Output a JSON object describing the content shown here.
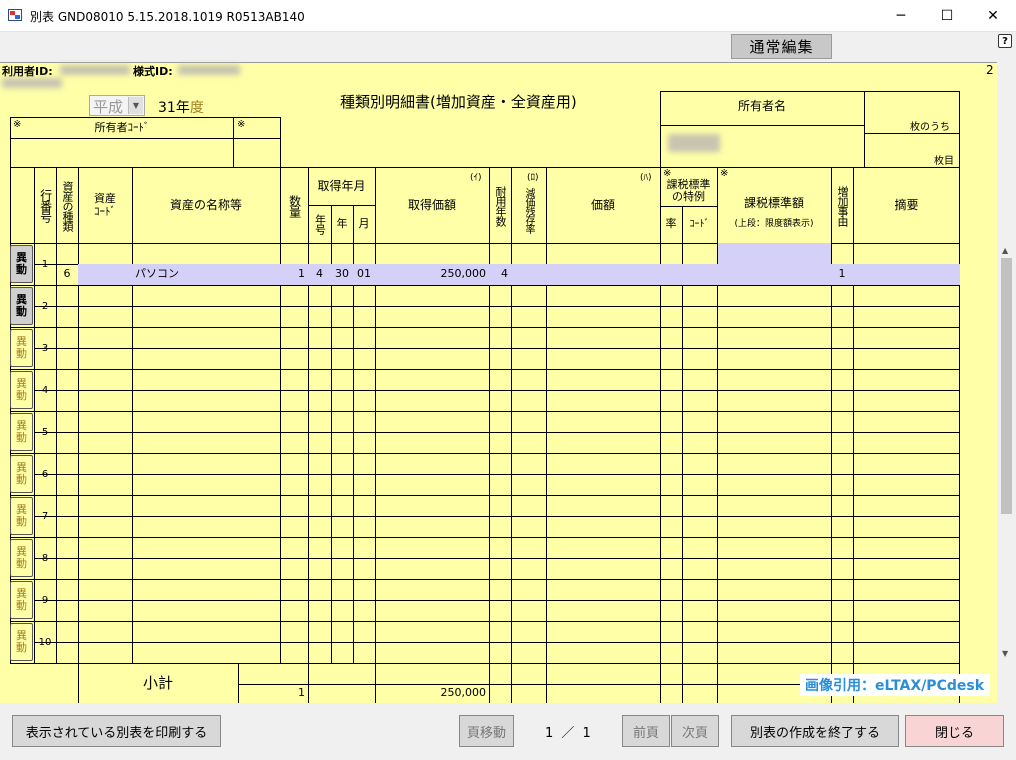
{
  "window": {
    "title": "別表 GND08010  5.15.2018.1019  R0513AB140",
    "minimize": "─",
    "maximize": "☐",
    "close": "✕"
  },
  "toolbar": {
    "mode_label": "通常編集",
    "help_icon": "?"
  },
  "header": {
    "user_id_label": "利用者ID:",
    "form_id_label": "様式ID:",
    "page_no": "2",
    "era": "平成",
    "year": "31年",
    "year_suffix": "度",
    "doc_title": "種類別明細書(増加資産・全資産用)",
    "owner_name_label": "所有者名",
    "sheet_of": "枚のうち",
    "sheet_no": "枚目",
    "owner_code_mark": "※",
    "owner_code_label": "所有者ｺｰﾄﾞ",
    "owner_code_mark2": "※"
  },
  "columns": {
    "row_no": "行番号",
    "asset_type": "資産の種類",
    "asset_code": "資産ｺｰﾄﾞ",
    "asset_name": "資産の名称等",
    "quantity": "数量",
    "acq_date": "取得年月",
    "acq_era": "年号",
    "acq_year": "年",
    "acq_month": "月",
    "acq_price_mark": "(ｲ)",
    "acq_price": "取得価額",
    "useful_life": "耐用年数",
    "residual_mark": "(ﾛ)",
    "residual": "減価残存率",
    "value_mark": "(ﾊ)",
    "value": "価額",
    "tax_special_mark": "※",
    "tax_special": "課税標準の特例",
    "tax_rate": "率",
    "tax_code": "ｺｰﾄﾞ",
    "tax_base_mark": "※",
    "tax_base": "課税標準額",
    "tax_base_note": "(上段：限度額表示)",
    "increase_reason": "増加事由",
    "remarks": "摘要"
  },
  "ido_label": "異動",
  "rows": [
    {
      "no": "1",
      "type": "6",
      "code": "",
      "name": "パソコン",
      "qty": "1",
      "era": "4",
      "year": "30",
      "month": "01",
      "price": "250,000",
      "life": "4",
      "reason": "1"
    },
    {
      "no": "2"
    },
    {
      "no": "3"
    },
    {
      "no": "4"
    },
    {
      "no": "5"
    },
    {
      "no": "6"
    },
    {
      "no": "7"
    },
    {
      "no": "8"
    },
    {
      "no": "9"
    },
    {
      "no": "10"
    }
  ],
  "subtotal": {
    "label": "小計",
    "qty": "1",
    "price": "250,000"
  },
  "watermark": "画像引用：eLTAX/PCdesk",
  "bottom": {
    "print_label": "表示されている別表を印刷する",
    "page_move_label": "頁移動",
    "page_indicator": "1 ／ 1",
    "prev_label": "前頁",
    "next_label": "次頁",
    "finish_label": "別表の作成を終了する",
    "close_label": "閉じる"
  }
}
